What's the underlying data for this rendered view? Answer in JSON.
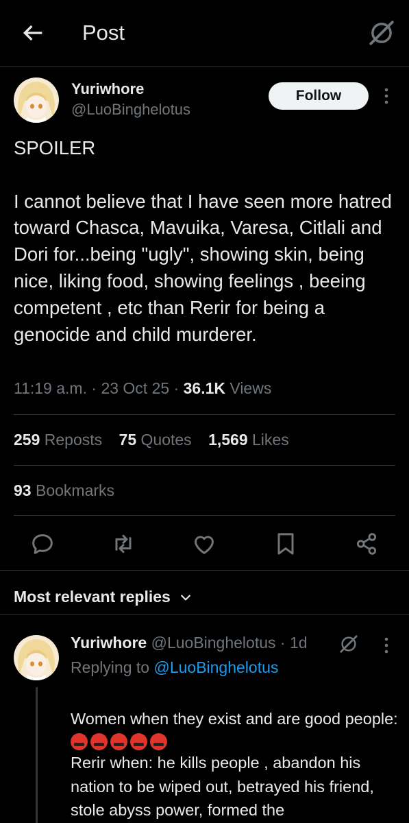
{
  "header": {
    "title": "Post"
  },
  "post": {
    "author_name": "Yuriwhore",
    "author_handle": "@LuoBinghelotus",
    "follow_label": "Follow",
    "text": "SPOILER\n\nI cannot believe that I have seen more hatred toward Chasca, Mavuika, Varesa, Citlali and Dori for...being \"ugly\", showing skin, being nice, liking food, showing feelings , beeing  competent , etc than Rerir for being a genocide and child murderer.",
    "time": "11:19 a.m.",
    "date": "23 Oct 25",
    "views_count": "36.1K",
    "views_label": "Views",
    "reposts_count": "259",
    "reposts_label": "Reposts",
    "quotes_count": "75",
    "quotes_label": "Quotes",
    "likes_count": "1,569",
    "likes_label": "Likes",
    "bookmarks_count": "93",
    "bookmarks_label": "Bookmarks"
  },
  "replies_section": {
    "label": "Most relevant replies"
  },
  "reply": {
    "author_name": "Yuriwhore",
    "author_handle": "@LuoBinghelotus",
    "age": "1d",
    "replying_prefix": "Replying to",
    "replying_to": "@LuoBinghelotus",
    "text_line1": "Women when they exist and are good people:",
    "text_body": "Rerir when:  he kills people , abandon his nation to be wiped out, betrayed his friend, stole abyss power, formed the",
    "emojis": [
      "enraged-face-emoji",
      "enraged-face-emoji",
      "enraged-face-emoji",
      "enraged-face-emoji",
      "enraged-face-emoji"
    ]
  },
  "colors": {
    "background": "#000000",
    "text": "#e7e9ea",
    "secondary": "#71767b",
    "link": "#1d9bf0",
    "divider": "#2f3336"
  }
}
